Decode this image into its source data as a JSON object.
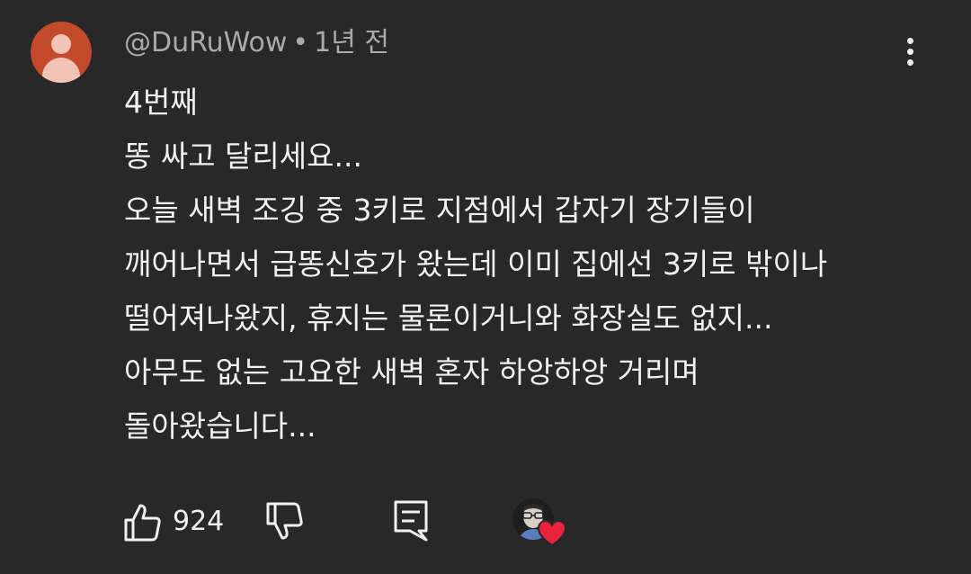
{
  "comment": {
    "author": "@DuRuWow",
    "separator": "•",
    "time": "1년 전",
    "lines": [
      "4번째",
      "똥 싸고 달리세요...",
      "오늘 새벽 조깅 중 3키로 지점에서 갑자기 장기들이",
      "깨어나면서 급똥신호가 왔는데 이미 집에선 3키로 밖이나",
      "떨어져나왔지, 휴지는 물론이거니와 화장실도 없지...",
      "아무도 없는 고요한 새벽 혼자 하앙하앙 거리며",
      "돌아왔습니다..."
    ]
  },
  "actions": {
    "like_count": "924"
  },
  "icons": {
    "avatar": "default-user-avatar-icon",
    "more": "more-vert-icon",
    "like": "thumbs-up-icon",
    "dislike": "thumbs-down-icon",
    "reply": "reply-comment-icon",
    "creator_heart": "creator-heart-icon"
  },
  "colors": {
    "background": "#282828",
    "avatar_bg": "#c44a2c",
    "avatar_figure": "#f1c3b6",
    "meta_text": "#aaaaaa",
    "text": "#f1f1f1",
    "heart": "#e8233c"
  }
}
